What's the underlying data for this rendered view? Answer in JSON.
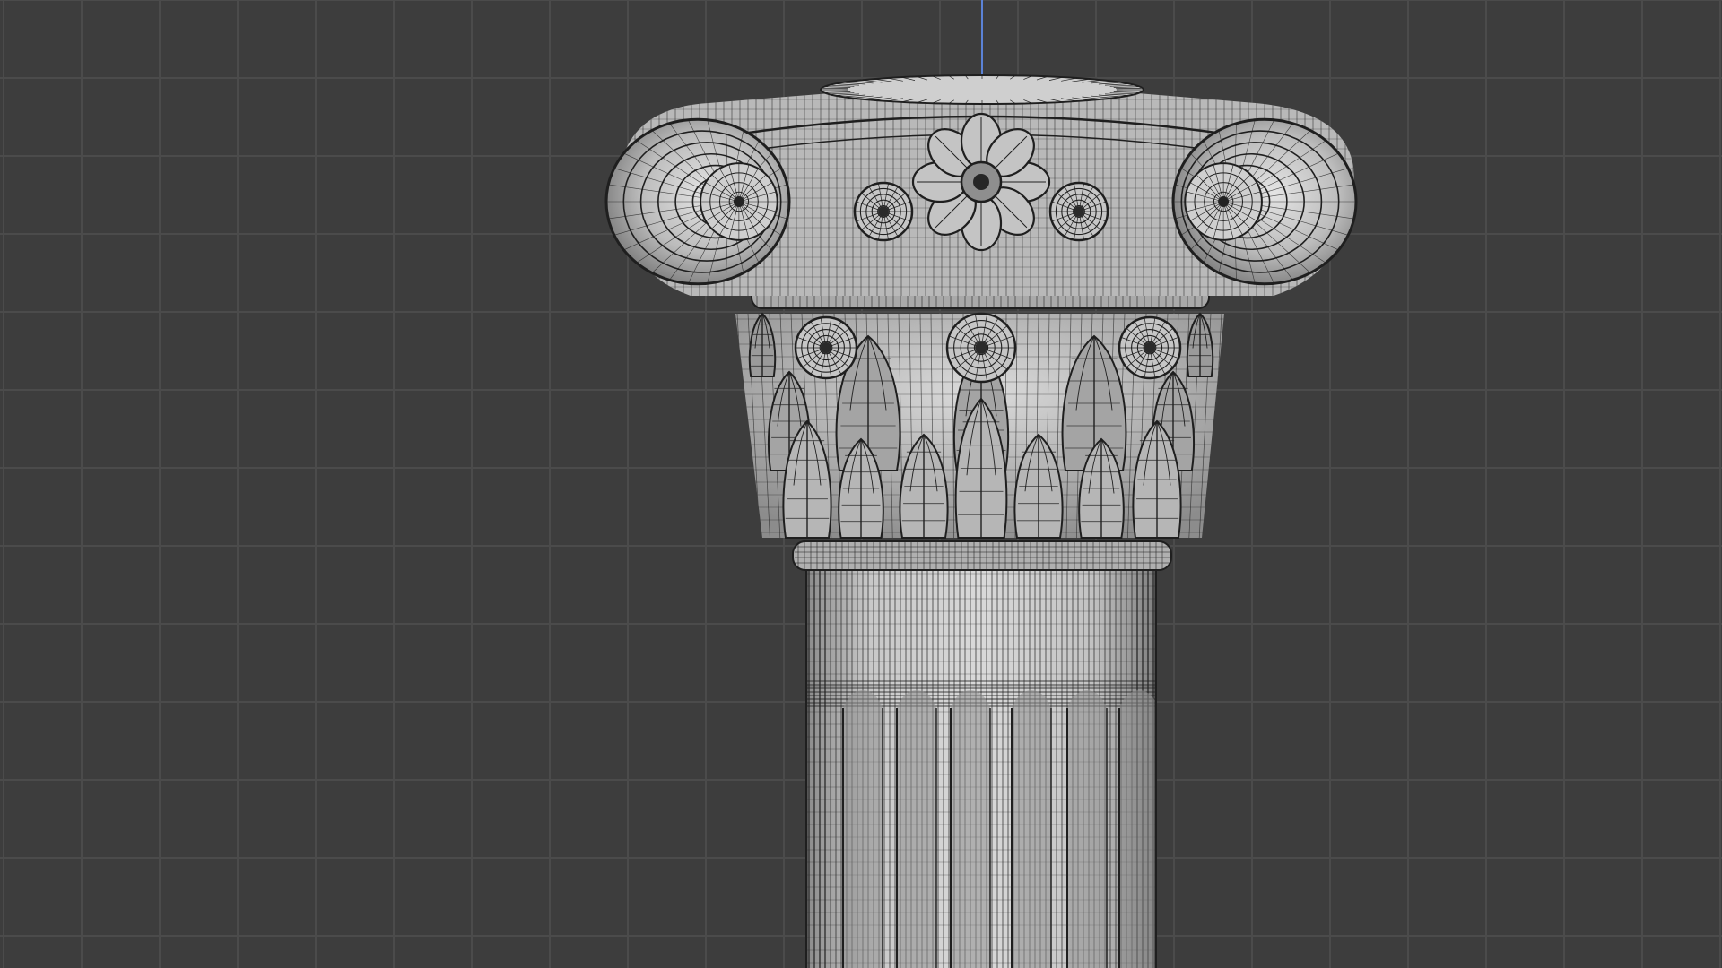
{
  "viewport": {
    "background_color": "#3d3d3d",
    "grid_line_color": "#4b4b4b",
    "z_axis_color": "#5b82d6"
  },
  "model": {
    "kind": "ionic-column-capital",
    "display_mode": "wireframe-over-solid",
    "surface_color": "#bdbdbd",
    "wire_color": "#1f1f1f",
    "shadow_color": "#8f8f8f",
    "highlight_color": "#e6e6e6"
  }
}
